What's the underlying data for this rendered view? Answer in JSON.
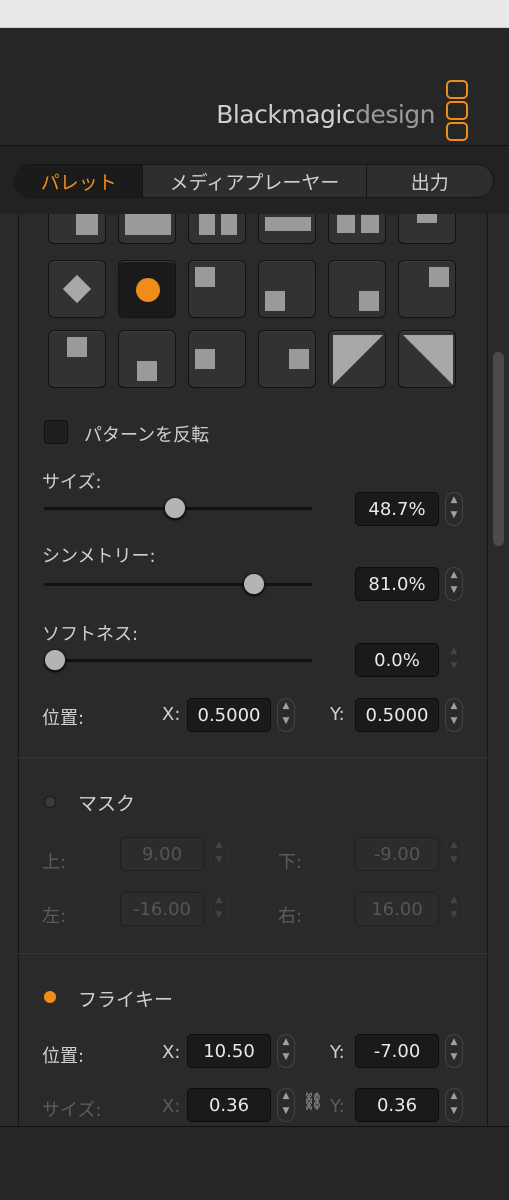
{
  "brand": {
    "bold": "Blackmagic",
    "light": "design"
  },
  "tabs": [
    {
      "label": "パレット",
      "active": true
    },
    {
      "label": "メディアプレーヤー",
      "active": false
    },
    {
      "label": "出力",
      "active": false
    }
  ],
  "pattern": {
    "invert_label": "パターンを反転",
    "size_label": "サイズ:",
    "size_value": "48.7%",
    "size_level": 0.487,
    "symmetry_label": "シンメトリー:",
    "symmetry_value": "81.0%",
    "symmetry_level": 0.81,
    "softness_label": "ソフトネス:",
    "softness_value": "0.0%",
    "softness_level": 0.0,
    "position_label": "位置:",
    "x_label": "X:",
    "x_value": "0.5000",
    "y_label": "Y:",
    "y_value": "0.5000"
  },
  "mask": {
    "title": "マスク",
    "enabled": false,
    "top_label": "上:",
    "top_value": "9.00",
    "bottom_label": "下:",
    "bottom_value": "-9.00",
    "left_label": "左:",
    "left_value": "-16.00",
    "right_label": "右:",
    "right_value": "16.00"
  },
  "flykey": {
    "title": "フライキー",
    "enabled": true,
    "position_label": "位置:",
    "pos_x_label": "X:",
    "pos_x_value": "10.50",
    "pos_y_label": "Y:",
    "pos_y_value": "-7.00",
    "size_label": "サイズ:",
    "size_x_label": "X:",
    "size_x_value": "0.36",
    "size_y_label": "Y:",
    "size_y_value": "0.36"
  },
  "colors": {
    "accent": "#f08c1a",
    "panel": "#2a2a2a",
    "field": "#1a1a1a"
  },
  "icons": [
    "checkbox-icon",
    "link-icon",
    "stepper-arrows-icon",
    "wipe-pattern-icons"
  ]
}
